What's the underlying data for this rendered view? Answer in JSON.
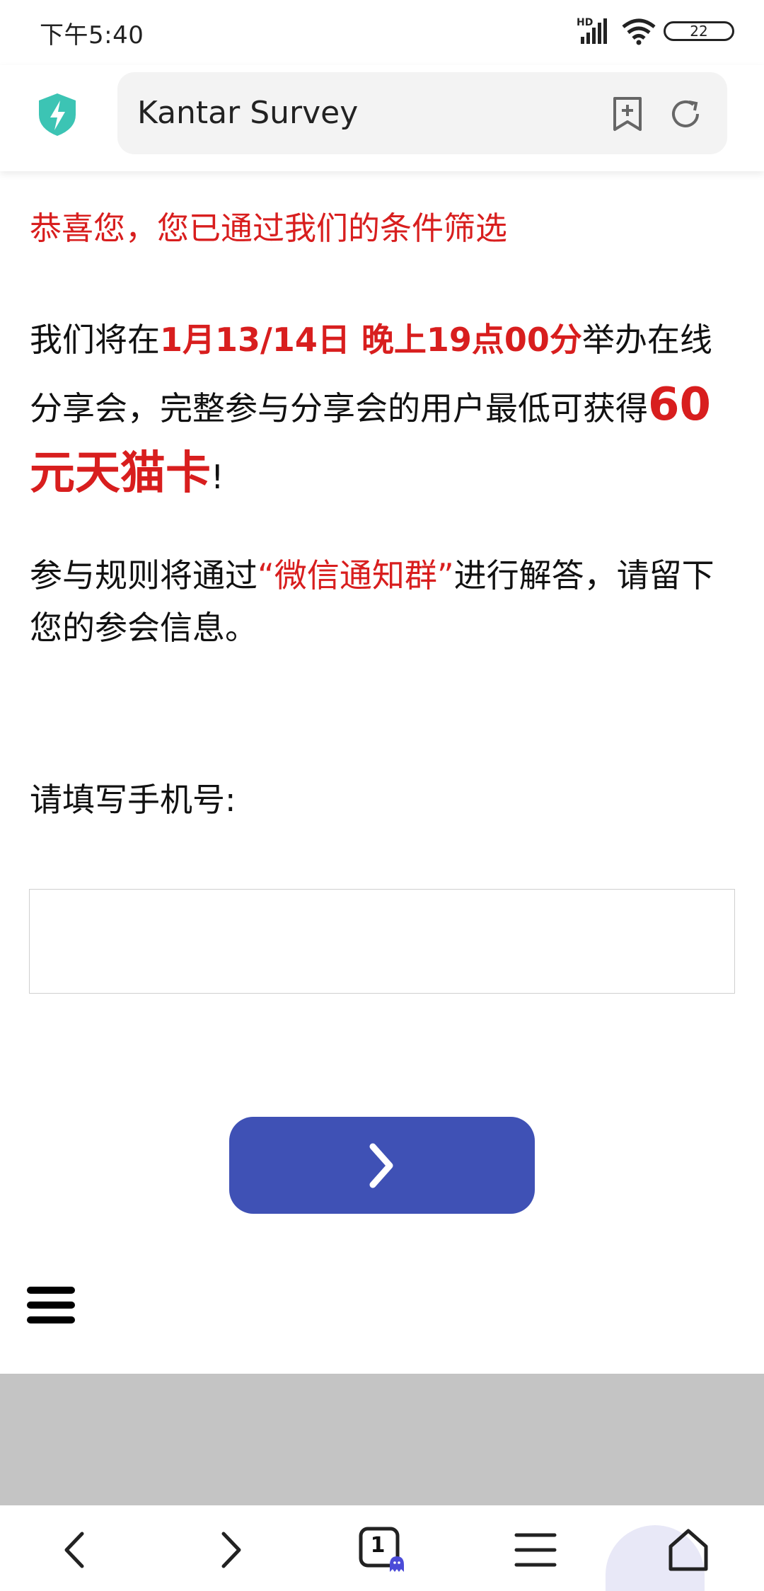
{
  "status_bar": {
    "time": "下午5:40",
    "network_label": "HD",
    "battery_level": "22"
  },
  "address_bar": {
    "url_title": "Kantar Survey"
  },
  "content": {
    "congrats": "恭喜您，您已通过我们的条件筛选",
    "para1_a": "我们将在",
    "para1_date": "1月13/14日 晚上19点00分",
    "para1_b": "举办在线分享会，完整参与分享会的用户最低可获得",
    "para1_reward": "60元天猫卡",
    "para1_end": "!",
    "para2_a": "参与规则将通过",
    "para2_group": "“微信通知群”",
    "para2_b": "进行解答，请留下您的参会信息。",
    "phone_label": "请填写手机号:",
    "phone_value": "",
    "phone_placeholder": ""
  },
  "bottom_nav": {
    "tab_count": "1"
  },
  "colors": {
    "accent_red": "#d81e1e",
    "button_blue": "#3f51b5",
    "shield_teal": "#3cc4b4"
  }
}
